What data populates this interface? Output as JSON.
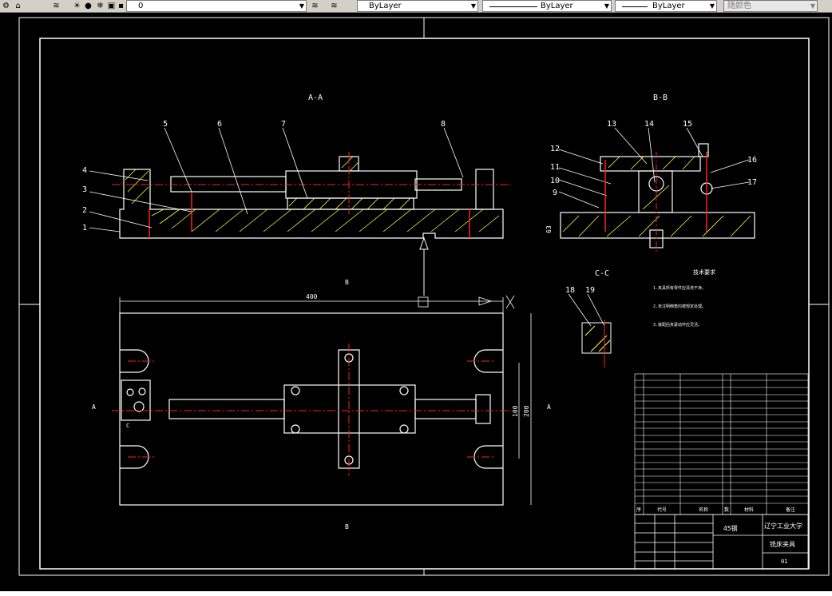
{
  "toolbar": {
    "layer_value": "0",
    "color_value": "ByLayer",
    "linetype_value": "ByLayer",
    "lineweight_value": "ByLayer",
    "plotstyle_value": "随颜色"
  },
  "drawing": {
    "section_aa": "A-A",
    "section_bb": "B-B",
    "section_cc": "C-C",
    "balloons": [
      "1",
      "2",
      "3",
      "4",
      "5",
      "6",
      "7",
      "8",
      "9",
      "10",
      "11",
      "12",
      "13",
      "14",
      "15",
      "16",
      "17",
      "18",
      "19"
    ],
    "dim_400": "400",
    "dim_100": "100",
    "dim_200": "200",
    "dim_63": "63",
    "label_a_left": "A",
    "label_a_right": "A",
    "label_b_top": "B",
    "label_b_bottom": "B",
    "label_c": "C",
    "notes_title": "技术要求",
    "notes": [
      "1.夹具所有零件应清洗干净。",
      "2.未注明倒角均按规定处理。",
      "3.装配后夹紧动作应灵活。"
    ]
  },
  "title_block": {
    "university": "辽宁工业大学",
    "drawing_name": "铣床夹具",
    "material": "45钢",
    "drawing_no": "01"
  },
  "bom_header": [
    "序",
    "代号",
    "名称",
    "数",
    "材料",
    "备注"
  ],
  "colors": {
    "outline": "#ffffff",
    "center": "#ff2020",
    "hatch": "#ffff40",
    "accent": "#00e0e0",
    "toolbar_bg": "#d4d0c8"
  }
}
